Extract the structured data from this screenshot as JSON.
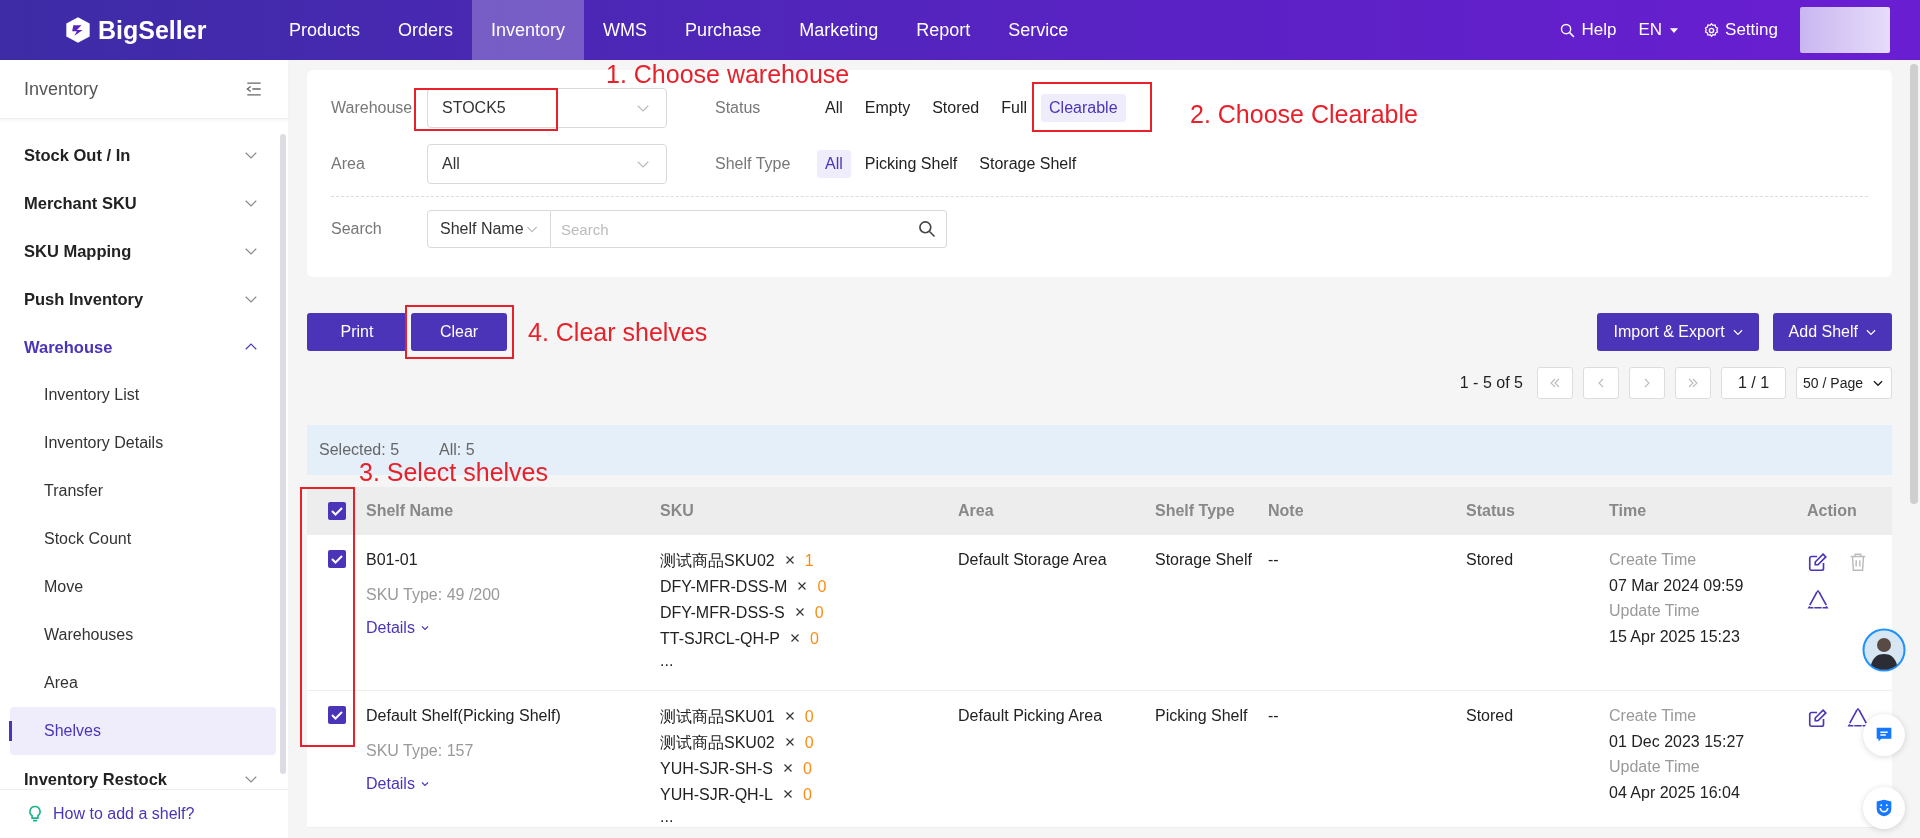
{
  "top_bar": {
    "logo": "BigSeller",
    "nav": [
      {
        "label": "Products",
        "selected": false
      },
      {
        "label": "Orders",
        "selected": false
      },
      {
        "label": "Inventory",
        "selected": true
      },
      {
        "label": "WMS",
        "selected": false
      },
      {
        "label": "Purchase",
        "selected": false
      },
      {
        "label": "Marketing",
        "selected": false
      },
      {
        "label": "Report",
        "selected": false
      },
      {
        "label": "Service",
        "selected": false
      }
    ],
    "help": "Help",
    "language": "EN",
    "setting": "Setting"
  },
  "sidebar": {
    "title": "Inventory",
    "items": [
      {
        "label": "Stock Out / In",
        "expanded": false,
        "selected": false
      },
      {
        "label": "Merchant SKU",
        "expanded": false,
        "selected": false
      },
      {
        "label": "SKU Mapping",
        "expanded": false,
        "selected": false
      },
      {
        "label": "Push Inventory",
        "expanded": false,
        "selected": false
      },
      {
        "label": "Warehouse",
        "expanded": true,
        "selected": true,
        "children": [
          {
            "label": "Inventory List",
            "selected": false
          },
          {
            "label": "Inventory Details",
            "selected": false
          },
          {
            "label": "Transfer",
            "selected": false
          },
          {
            "label": "Stock Count",
            "selected": false
          },
          {
            "label": "Move",
            "selected": false
          },
          {
            "label": "Warehouses",
            "selected": false
          },
          {
            "label": "Area",
            "selected": false
          },
          {
            "label": "Shelves",
            "selected": true
          }
        ]
      },
      {
        "label": "Inventory Restock",
        "expanded": false,
        "selected": false
      }
    ],
    "help_link": "How to add a shelf?"
  },
  "filters": {
    "warehouse": {
      "label": "Warehouse",
      "value": "STOCK5"
    },
    "status": {
      "label": "Status",
      "options": [
        {
          "label": "All",
          "selected": false
        },
        {
          "label": "Empty",
          "selected": false
        },
        {
          "label": "Stored",
          "selected": false
        },
        {
          "label": "Full",
          "selected": false
        },
        {
          "label": "Clearable",
          "selected": true
        }
      ]
    },
    "area": {
      "label": "Area",
      "value": "All"
    },
    "shelf_type": {
      "label": "Shelf Type",
      "options": [
        {
          "label": "All",
          "selected": true
        },
        {
          "label": "Picking Shelf",
          "selected": false
        },
        {
          "label": "Storage Shelf",
          "selected": false
        }
      ]
    },
    "search": {
      "label": "Search",
      "field": "Shelf Name",
      "placeholder": "Search"
    }
  },
  "toolbar": {
    "left_buttons": [
      "Print",
      "Clear"
    ],
    "right_buttons": [
      "Import & Export",
      "Add Shelf"
    ]
  },
  "pagination": {
    "range": "1 - 5 of 5",
    "page": "1 / 1",
    "page_size": "50 / Page"
  },
  "selection_bar": {
    "selected": "Selected: 5",
    "all": "All: 5"
  },
  "table": {
    "all_checked": true,
    "columns": [
      "Shelf Name",
      "SKU",
      "Area",
      "Shelf Type",
      "Note",
      "Status",
      "Time",
      "Action"
    ],
    "rows": [
      {
        "checked": true,
        "shelf_name": "B01-01",
        "sku_type": "SKU Type: 49 /200",
        "details": "Details",
        "skus": [
          {
            "code": "测试商品SKU02",
            "qty": "1"
          },
          {
            "code": "DFY-MFR-DSS-M",
            "qty": "0"
          },
          {
            "code": "DFY-MFR-DSS-S",
            "qty": "0"
          },
          {
            "code": "TT-SJRCL-QH-P",
            "qty": "0"
          }
        ],
        "more": "...",
        "area": "Default Storage Area",
        "shelf_type": "Storage Shelf",
        "note": "--",
        "status": "Stored",
        "create_label": "Create Time",
        "create_time": "07 Mar 2024 09:59",
        "update_label": "Update Time",
        "update_time": "15 Apr 2025 15:23",
        "actions": [
          {
            "kind": "edit",
            "disabled": false
          },
          {
            "kind": "delete",
            "disabled": true
          },
          {
            "kind": "recycle",
            "disabled": false
          }
        ]
      },
      {
        "checked": true,
        "shelf_name": "Default Shelf(Picking Shelf)",
        "sku_type": "SKU Type: 157",
        "details": "Details",
        "skus": [
          {
            "code": "测试商品SKU01",
            "qty": "0"
          },
          {
            "code": "测试商品SKU02",
            "qty": "0"
          },
          {
            "code": "YUH-SJR-SH-S",
            "qty": "0"
          },
          {
            "code": "YUH-SJR-QH-L",
            "qty": "0"
          }
        ],
        "more": "...",
        "area": "Default Picking Area",
        "shelf_type": "Picking Shelf",
        "note": "--",
        "status": "Stored",
        "create_label": "Create Time",
        "create_time": "01 Dec 2023 15:27",
        "update_label": "Update Time",
        "update_time": "04 Apr 2025 16:04",
        "actions": [
          {
            "kind": "edit",
            "disabled": false
          },
          {
            "kind": "recycle",
            "disabled": false
          }
        ]
      }
    ]
  },
  "annotations": [
    {
      "kind": "warehouse",
      "text": "1. Choose warehouse"
    },
    {
      "kind": "status",
      "text": "2. Choose Clearable"
    },
    {
      "kind": "checkboxes",
      "text": "3. Select shelves"
    },
    {
      "kind": "clear",
      "text": "4. Clear shelves"
    }
  ]
}
